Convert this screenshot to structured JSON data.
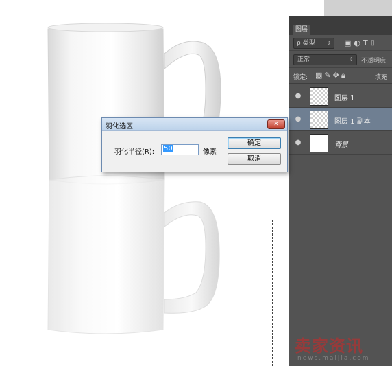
{
  "layers_panel": {
    "tab_label": "图层",
    "filter_kind": "ρ 类型",
    "filter_icons": [
      "image-filter-icon",
      "adjustment-filter-icon",
      "type-filter-icon"
    ],
    "blend_mode": "正常",
    "opacity_label": "不透明度",
    "lock_label": "锁定:",
    "fill_label": "填充",
    "layers": [
      {
        "name": "图层 1",
        "selected": false,
        "thumbnail": "transparent"
      },
      {
        "name": "图层 1 副本",
        "selected": true,
        "thumbnail": "transparent"
      },
      {
        "name": "背景",
        "selected": false,
        "thumbnail": "white"
      }
    ]
  },
  "feather_dialog": {
    "title": "羽化选区",
    "radius_label": "羽化半径(R):",
    "radius_value": "50",
    "unit_label": "像素",
    "ok_label": "确定",
    "cancel_label": "取消",
    "close_symbol": "✕"
  },
  "watermark": {
    "text": "卖家资讯",
    "sub": "news.maijia.com"
  },
  "colors": {
    "panel_bg": "#535353",
    "selected_layer": "#6f7f92",
    "dialog_title_bar": "#bcd2ea",
    "close_button": "#c2402f",
    "selection_highlight": "#3399ff"
  }
}
